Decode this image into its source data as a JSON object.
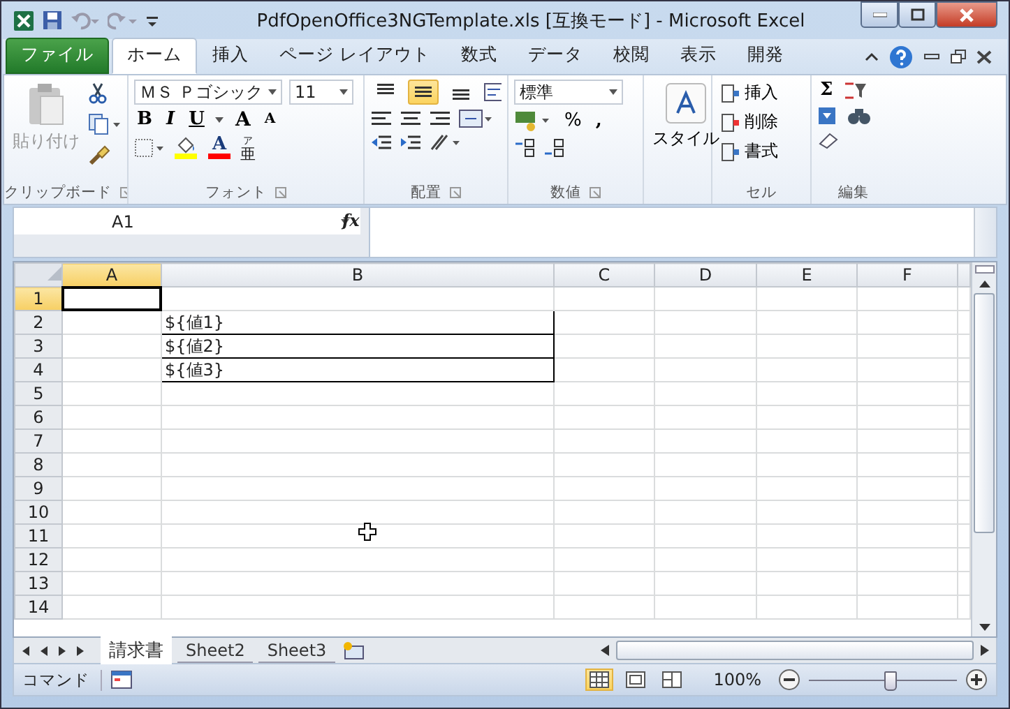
{
  "window": {
    "title": "PdfOpenOffice3NGTemplate.xls  [互換モード] - Microsoft Excel"
  },
  "ribbon_tabs": [
    {
      "label": "ファイル",
      "kind": "file",
      "selected": false
    },
    {
      "label": "ホーム",
      "kind": "tab",
      "selected": true
    },
    {
      "label": "挿入",
      "kind": "tab",
      "selected": false
    },
    {
      "label": "ページ レイアウト",
      "kind": "tab",
      "selected": false
    },
    {
      "label": "数式",
      "kind": "tab",
      "selected": false
    },
    {
      "label": "データ",
      "kind": "tab",
      "selected": false
    },
    {
      "label": "校閲",
      "kind": "tab",
      "selected": false
    },
    {
      "label": "表示",
      "kind": "tab",
      "selected": false
    },
    {
      "label": "開発",
      "kind": "tab",
      "selected": false
    }
  ],
  "clipboard": {
    "paste": "貼り付け",
    "label": "クリップボード"
  },
  "font": {
    "name": "ＭＳ Ｐゴシック",
    "size": "11",
    "bold": "B",
    "italic": "I",
    "underline": "U",
    "grow": "A",
    "shrink": "A",
    "font_color_letter": "A",
    "phonetic_top": "ア",
    "phonetic": "亜",
    "label": "フォント"
  },
  "alignment": {
    "vertical": [
      {
        "selected": false
      },
      {
        "selected": true
      },
      {
        "selected": false
      }
    ],
    "label": "配置"
  },
  "number": {
    "format": "標準",
    "percent": "%",
    "comma": ",",
    "label": "数値"
  },
  "styles": {
    "button": "スタイル"
  },
  "cells": {
    "buttons": [
      "挿入",
      "削除",
      "書式"
    ],
    "label": "セル"
  },
  "editing": {
    "sum": "Σ",
    "label": "編集"
  },
  "formula_bar": {
    "name_box": "A1",
    "fx": "fx"
  },
  "columns": [
    {
      "label": "A",
      "selected": true
    },
    {
      "label": "B",
      "selected": false
    },
    {
      "label": "C",
      "selected": false
    },
    {
      "label": "D",
      "selected": false
    },
    {
      "label": "E",
      "selected": false
    },
    {
      "label": "F",
      "selected": false
    }
  ],
  "rows": [
    {
      "label": "1",
      "selected": true,
      "cells": []
    },
    {
      "label": "2",
      "selected": false,
      "cells": [
        null,
        {
          "value": "${値1}",
          "bordered": true
        },
        null,
        null,
        null,
        null
      ]
    },
    {
      "label": "3",
      "selected": false,
      "cells": [
        null,
        {
          "value": "${値2}",
          "bordered": true
        },
        null,
        null,
        null,
        null
      ]
    },
    {
      "label": "4",
      "selected": false,
      "cells": [
        null,
        {
          "value": "${値3}",
          "bordered": true
        },
        null,
        null,
        null,
        null
      ]
    },
    {
      "label": "5",
      "selected": false,
      "cells": []
    },
    {
      "label": "6",
      "selected": false,
      "cells": []
    },
    {
      "label": "7",
      "selected": false,
      "cells": []
    },
    {
      "label": "8",
      "selected": false,
      "cells": []
    },
    {
      "label": "9",
      "selected": false,
      "cells": []
    },
    {
      "label": "10",
      "selected": false,
      "cells": []
    },
    {
      "label": "11",
      "selected": false,
      "cells": []
    },
    {
      "label": "12",
      "selected": false,
      "cells": []
    },
    {
      "label": "13",
      "selected": false,
      "cells": []
    },
    {
      "label": "14",
      "selected": false,
      "cells": []
    }
  ],
  "sheet_tabs": [
    {
      "label": "請求書",
      "selected": true
    },
    {
      "label": "Sheet2",
      "selected": false
    },
    {
      "label": "Sheet3",
      "selected": false
    }
  ],
  "status_bar": {
    "mode": "コマンド",
    "views": [
      {
        "selected": true
      },
      {
        "selected": false
      },
      {
        "selected": false
      }
    ],
    "zoom": "100%",
    "zoom_slider": {
      "level": 0.55
    }
  }
}
